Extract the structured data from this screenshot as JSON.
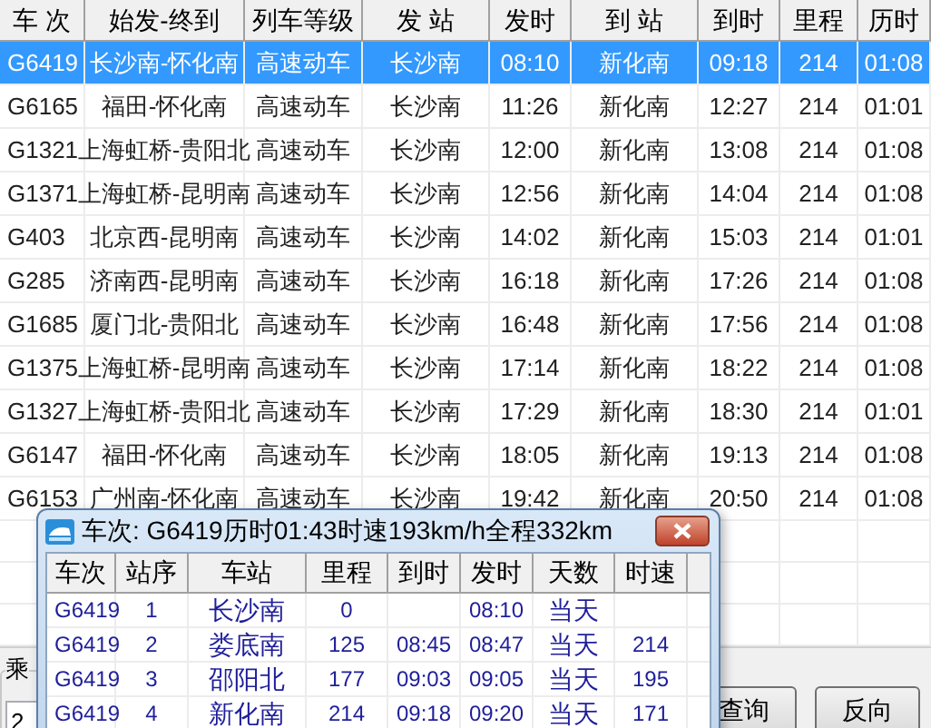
{
  "table": {
    "columns": [
      "车 次",
      "始发-终到",
      "列车等级",
      "发 站",
      "发时",
      "到 站",
      "到时",
      "里程",
      "历时"
    ],
    "rows": [
      {
        "selected": true,
        "cells": [
          "G6419",
          "长沙南-怀化南",
          "高速动车",
          "长沙南",
          "08:10",
          "新化南",
          "09:18",
          "214",
          "01:08"
        ]
      },
      {
        "selected": false,
        "cells": [
          "G6165",
          "福田-怀化南",
          "高速动车",
          "长沙南",
          "11:26",
          "新化南",
          "12:27",
          "214",
          "01:01"
        ]
      },
      {
        "selected": false,
        "cells": [
          "G1321",
          "上海虹桥-贵阳北",
          "高速动车",
          "长沙南",
          "12:00",
          "新化南",
          "13:08",
          "214",
          "01:08"
        ]
      },
      {
        "selected": false,
        "cells": [
          "G1371",
          "上海虹桥-昆明南",
          "高速动车",
          "长沙南",
          "12:56",
          "新化南",
          "14:04",
          "214",
          "01:08"
        ]
      },
      {
        "selected": false,
        "cells": [
          "G403",
          "北京西-昆明南",
          "高速动车",
          "长沙南",
          "14:02",
          "新化南",
          "15:03",
          "214",
          "01:01"
        ]
      },
      {
        "selected": false,
        "cells": [
          "G285",
          "济南西-昆明南",
          "高速动车",
          "长沙南",
          "16:18",
          "新化南",
          "17:26",
          "214",
          "01:08"
        ]
      },
      {
        "selected": false,
        "cells": [
          "G1685",
          "厦门北-贵阳北",
          "高速动车",
          "长沙南",
          "16:48",
          "新化南",
          "17:56",
          "214",
          "01:08"
        ]
      },
      {
        "selected": false,
        "cells": [
          "G1375",
          "上海虹桥-昆明南",
          "高速动车",
          "长沙南",
          "17:14",
          "新化南",
          "18:22",
          "214",
          "01:08"
        ]
      },
      {
        "selected": false,
        "cells": [
          "G1327",
          "上海虹桥-贵阳北",
          "高速动车",
          "长沙南",
          "17:29",
          "新化南",
          "18:30",
          "214",
          "01:01"
        ]
      },
      {
        "selected": false,
        "cells": [
          "G6147",
          "福田-怀化南",
          "高速动车",
          "长沙南",
          "18:05",
          "新化南",
          "19:13",
          "214",
          "01:08"
        ]
      },
      {
        "selected": false,
        "cells": [
          "G6153",
          "广州南-怀化南",
          "高速动车",
          "长沙南",
          "19:42",
          "新化南",
          "20:50",
          "214",
          "01:08"
        ]
      }
    ]
  },
  "bottom_panel": {
    "group_label": "乘",
    "input": {
      "value": "2"
    },
    "buttons": [
      "查询",
      "反向"
    ]
  },
  "popup": {
    "title": "车次: G6419历时01:43时速193km/h全程332km",
    "columns": [
      "车次",
      "站序",
      "车站",
      "里程",
      "到时",
      "发时",
      "天数",
      "时速"
    ],
    "rows": [
      [
        "G6419",
        "1",
        "长沙南",
        "0",
        "",
        "08:10",
        "当天",
        ""
      ],
      [
        "G6419",
        "2",
        "娄底南",
        "125",
        "08:45",
        "08:47",
        "当天",
        "214"
      ],
      [
        "G6419",
        "3",
        "邵阳北",
        "177",
        "09:03",
        "09:05",
        "当天",
        "195"
      ],
      [
        "G6419",
        "4",
        "新化南",
        "214",
        "09:18",
        "09:20",
        "当天",
        "171"
      ]
    ]
  }
}
